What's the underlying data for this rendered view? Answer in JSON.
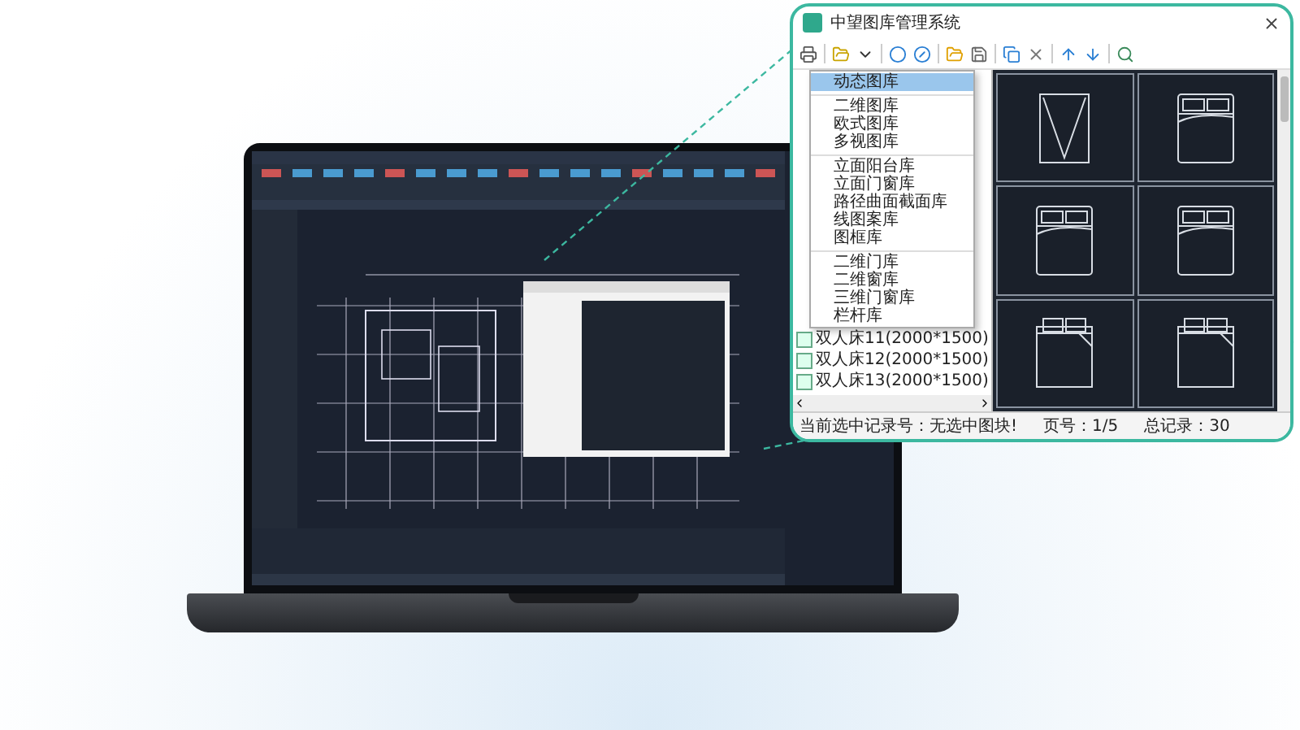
{
  "window": {
    "title": "中望图库管理系统"
  },
  "menu": {
    "items": [
      {
        "label": "动态图库",
        "selected": true,
        "group_start": false
      },
      {
        "label": "二维图库",
        "selected": false,
        "group_start": true
      },
      {
        "label": "欧式图库",
        "selected": false,
        "group_start": false
      },
      {
        "label": "多视图库",
        "selected": false,
        "group_start": false
      },
      {
        "label": "立面阳台库",
        "selected": false,
        "group_start": true
      },
      {
        "label": "立面门窗库",
        "selected": false,
        "group_start": false
      },
      {
        "label": "路径曲面截面库",
        "selected": false,
        "group_start": false
      },
      {
        "label": "线图案库",
        "selected": false,
        "group_start": false
      },
      {
        "label": "图框库",
        "selected": false,
        "group_start": false
      },
      {
        "label": "二维门库",
        "selected": false,
        "group_start": true
      },
      {
        "label": "二维窗库",
        "selected": false,
        "group_start": false
      },
      {
        "label": "三维门窗库",
        "selected": false,
        "group_start": false
      },
      {
        "label": "栏杆库",
        "selected": false,
        "group_start": false
      }
    ]
  },
  "tree": {
    "items": [
      {
        "label": "双人床11(2000*1500)"
      },
      {
        "label": "双人床12(2000*1500)"
      },
      {
        "label": "双人床13(2000*1500)"
      }
    ]
  },
  "preview": {
    "cells": [
      {
        "kind": "wardrobe"
      },
      {
        "kind": "bed"
      },
      {
        "kind": "bed"
      },
      {
        "kind": "bed"
      },
      {
        "kind": "bed-corner"
      },
      {
        "kind": "bed-corner"
      }
    ]
  },
  "status_bar": {
    "selection": "当前选中记录号：无选中图块!",
    "page": "页号：1/5",
    "total": "总记录：30"
  }
}
